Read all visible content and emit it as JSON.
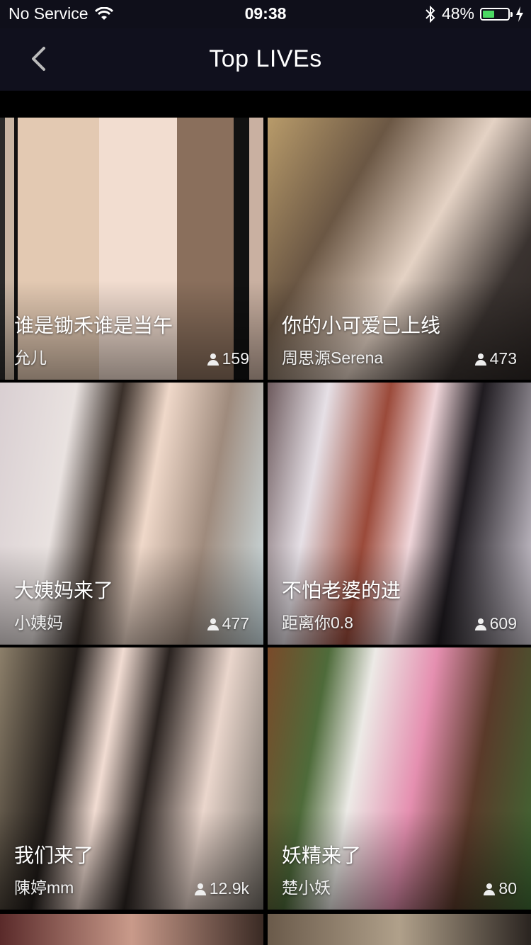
{
  "status_bar": {
    "carrier": "No Service",
    "time": "09:38",
    "battery": "48%",
    "battery_level": 0.48
  },
  "nav": {
    "title": "Top LIVEs"
  },
  "cards": [
    {
      "title": "谁是锄禾谁是当午",
      "name": "允儿",
      "viewers": "159"
    },
    {
      "title": "你的小可爱已上线",
      "name": "周思源Serena",
      "viewers": "473"
    },
    {
      "title": "大姨妈来了",
      "name": "小姨妈",
      "viewers": "477"
    },
    {
      "title": "不怕老婆的进",
      "name": "距离你0.8",
      "viewers": "609"
    },
    {
      "title": "我们来了",
      "name": "陳婷mm",
      "viewers": "12.9k"
    },
    {
      "title": "妖精来了",
      "name": "楚小妖",
      "viewers": "80"
    }
  ],
  "icons": [
    "wifi-icon",
    "bluetooth-icon",
    "battery-icon",
    "charging-icon",
    "back-chevron-icon",
    "person-icon"
  ],
  "colors": {
    "nav_bg": "#10101d",
    "battery_fill": "#4cd964"
  }
}
